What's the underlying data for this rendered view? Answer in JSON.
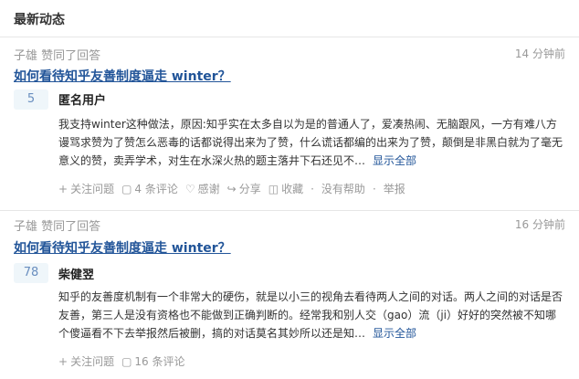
{
  "header": {
    "title": "最新动态"
  },
  "items": [
    {
      "source": "子雄 赞同了回答",
      "time": "14 分钟前",
      "question": "如何看待知乎友善制度逼走 winter？",
      "votes": "5",
      "author": "匿名用户",
      "content": "我支持winter这种做法，原因:知乎实在太多自以为是的普通人了，爱凑热闹、无脑跟风，一方有难八方谩骂求赞为了赞怎么恶毒的话都说得出来为了赞，什么谎话都编的出来为了赞，颠倒是非黑白就为了毫无意义的赞，卖弄学术，对生在水深火热的题主落井下石还见不…",
      "more": "显示全部",
      "actions": {
        "follow": "关注问题",
        "comments": "4 条评论",
        "thanks": "感谢",
        "share": "分享",
        "collect": "收藏",
        "nohelp": "没有帮助",
        "report": "举报"
      }
    },
    {
      "source": "子雄 赞同了回答",
      "time": "16 分钟前",
      "question": "如何看待知乎友善制度逼走 winter？",
      "votes": "78",
      "author": "柴健翌",
      "content": "知乎的友善度机制有一个非常大的硬伤，就是以小三的视角去看待两人之间的对话。两人之间的对话是否友善，第三人是没有资格也不能做到正确判断的。经常我和别人交（gao）流（ji）好好的突然被不知哪个傻逼看不下去举报然后被删，搞的对话莫名其妙所以还是知…",
      "more": "显示全部",
      "actions": {
        "follow": "关注问题",
        "comments": "16 条评论"
      }
    }
  ]
}
